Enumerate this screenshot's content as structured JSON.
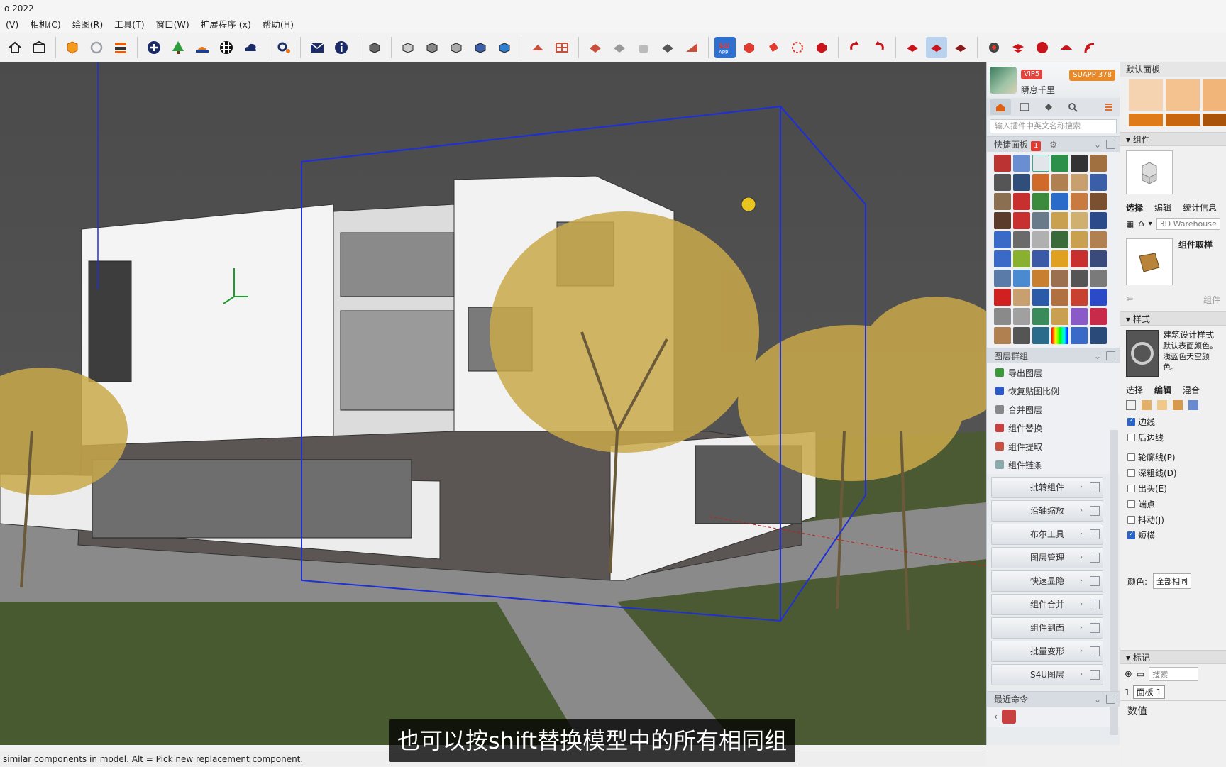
{
  "window": {
    "title": "o 2022"
  },
  "menu": [
    "(V)",
    "相机(C)",
    "绘图(R)",
    "工具(T)",
    "窗口(W)",
    "扩展程序 (x)",
    "帮助(H)"
  ],
  "status_text": "similar components in model. Alt = Pick new replacement component.",
  "subtitle": "也可以按shift替换模型中的所有相同组",
  "plugin": {
    "vip": "VIP5",
    "username": "瞬息千里",
    "version": "SUAPP 378",
    "search_placeholder": "输入插件中英文名称搜索",
    "quick_panel": "快捷面板",
    "quick_badge": "1",
    "layer_group": "图层群组",
    "layer_items": [
      "导出图层",
      "恢复贴图比例",
      "合并图层",
      "组件替换",
      "组件提取",
      "组件链条"
    ],
    "tool_buttons": [
      "批转组件",
      "沿轴缩放",
      "布尔工具",
      "图层管理",
      "快速显隐",
      "组件合并",
      "组件到面",
      "批量变形",
      "S4U图层"
    ],
    "recent": "最近命令"
  },
  "tray": {
    "default_panel": "默认面板",
    "components": "组件",
    "comp_tabs": [
      "选择",
      "编辑",
      "统计信息"
    ],
    "warehouse": "3D Warehouse",
    "comp_sample": "组件取样",
    "comp_link": "组件",
    "styles": "样式",
    "style_name": "建筑设计样式",
    "style_desc": "默认表面颜色。浅蓝色天空颜色。",
    "style_tabs": [
      "选择",
      "编辑",
      "混合"
    ],
    "checks": [
      {
        "label": "边线",
        "on": true
      },
      {
        "label": "后边线",
        "on": false
      },
      {
        "label": "轮廓线(P)",
        "on": false
      },
      {
        "label": "深粗线(D)",
        "on": false
      },
      {
        "label": "出头(E)",
        "on": false
      },
      {
        "label": "端点",
        "on": false
      },
      {
        "label": "抖动(J)",
        "on": false
      },
      {
        "label": "短横",
        "on": true
      }
    ],
    "color_label": "颜色:",
    "color_value": "全部相同",
    "tags": "标记",
    "tags_search": "搜索",
    "panel_tab_num": "1",
    "panel_tab": "面板 1",
    "numeric": "数值"
  },
  "colors": {
    "accent": "#1f2fd6",
    "tree": "#c9a94a",
    "swatch1": "#f6d3b0",
    "swatch2": "#f3c28f",
    "swatch3": "#e07b1a"
  }
}
